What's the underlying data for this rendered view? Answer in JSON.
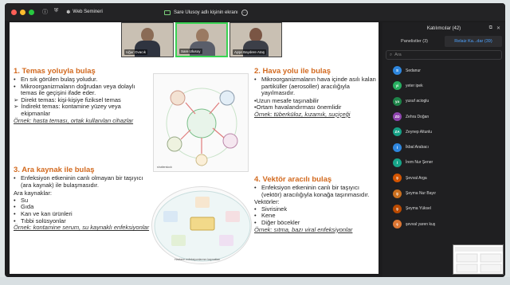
{
  "window": {
    "webinar_label": "Web Semineri",
    "share_title": "Sare Ulusoy adlı kişinin ekranı"
  },
  "videos": [
    {
      "name": "Uğur Ovacık"
    },
    {
      "name": "Sare Ulusoy"
    },
    {
      "name": "Ayşe Baydere Ataş"
    }
  ],
  "slide": {
    "s1": {
      "title": "1. Temas yoluyla bulaş",
      "bullets": [
        "En sık görülen bulaş yoludur.",
        "Mikroorganizmaların doğrudan veya dolaylı temas ile geçişini ifade eder."
      ],
      "arrows": [
        "Direkt temas: kişi-kişiye fiziksel temas",
        "İndirekt temas: kontamine yüzey veya ekipmanlar"
      ],
      "example": "Örnek: hasta teması, ortak kullanılan cihazlar"
    },
    "s2": {
      "title": "2. Hava yolu ile bulaş",
      "bullets": [
        "Mikroorganizmaların hava içinde asılı kalan partiküller (aerosoller) aracılığıyla yayılmasıdır."
      ],
      "lines": [
        "•Uzun mesafe taşınabilir",
        "•Ortam havalandırması önemlidir"
      ],
      "example": "Örnek: tüberküloz, kızamık, suçiçeği"
    },
    "s3": {
      "title": "3. Ara kaynak ile bulaş",
      "bullets": [
        "Enfeksiyon etkeninin canlı olmayan bir taşıyıcı (ara kaynak) ile bulaşmasıdır."
      ],
      "sub": "Ara kaynaklar:",
      "items": [
        "Su",
        "Gıda",
        "Kan ve kan ürünleri",
        "Tıbbi solüsyonlar"
      ],
      "example": "Örnek: kontamine serum, su kaynaklı enfeksiyonlar"
    },
    "s4": {
      "title": "4. Vektör aracılı bulaş",
      "bullets": [
        "Enfeksiyon etkeninin canlı bir taşıyıcı (vektör) aracılığıyla konağa taşınmasıdır."
      ],
      "sub": "Vektörler:",
      "items": [
        "Sivrisinek",
        "Kene",
        "Diğer böcekler"
      ],
      "example": "Örnek: sıtma, bazı viral enfeksiyonlar"
    },
    "img1_caption": "shutterstock",
    "img2_caption": "Hastane enfeksiyonlarının kaynakları"
  },
  "panel": {
    "title": "Katılımcılar (42)",
    "tab1": "Panelistler (3)",
    "tab2": "Relaiz Ka...dar (39)",
    "search_placeholder": "Ara",
    "participants": [
      {
        "initials": "S",
        "name": "Sedanur",
        "color": "#2e86de"
      },
      {
        "initials": "yi",
        "name": "yeter ipek",
        "color": "#27ae60"
      },
      {
        "initials": "ya",
        "name": "yusuf acioglu",
        "color": "#1e8449"
      },
      {
        "initials": "ZD",
        "name": "Zehra Doğan",
        "color": "#8e44ad"
      },
      {
        "initials": "ZA",
        "name": "Zeynep Altunlu",
        "color": "#16a085"
      },
      {
        "initials": "İ",
        "name": "İkbal Arabacı",
        "color": "#2e86de"
      },
      {
        "initials": "İ",
        "name": "İrem Nur Şener",
        "color": "#17a589"
      },
      {
        "initials": "Ş",
        "name": "Şevval Arga",
        "color": "#d35400"
      },
      {
        "initials": "Ş",
        "name": "Şeyma Nur Bayır",
        "color": "#ca6f1e"
      },
      {
        "initials": "Ş",
        "name": "Şeyma Yüksel",
        "color": "#ba4a00"
      },
      {
        "initials": "ş",
        "name": "şevval yaren kuş",
        "color": "#dc7633"
      }
    ]
  }
}
